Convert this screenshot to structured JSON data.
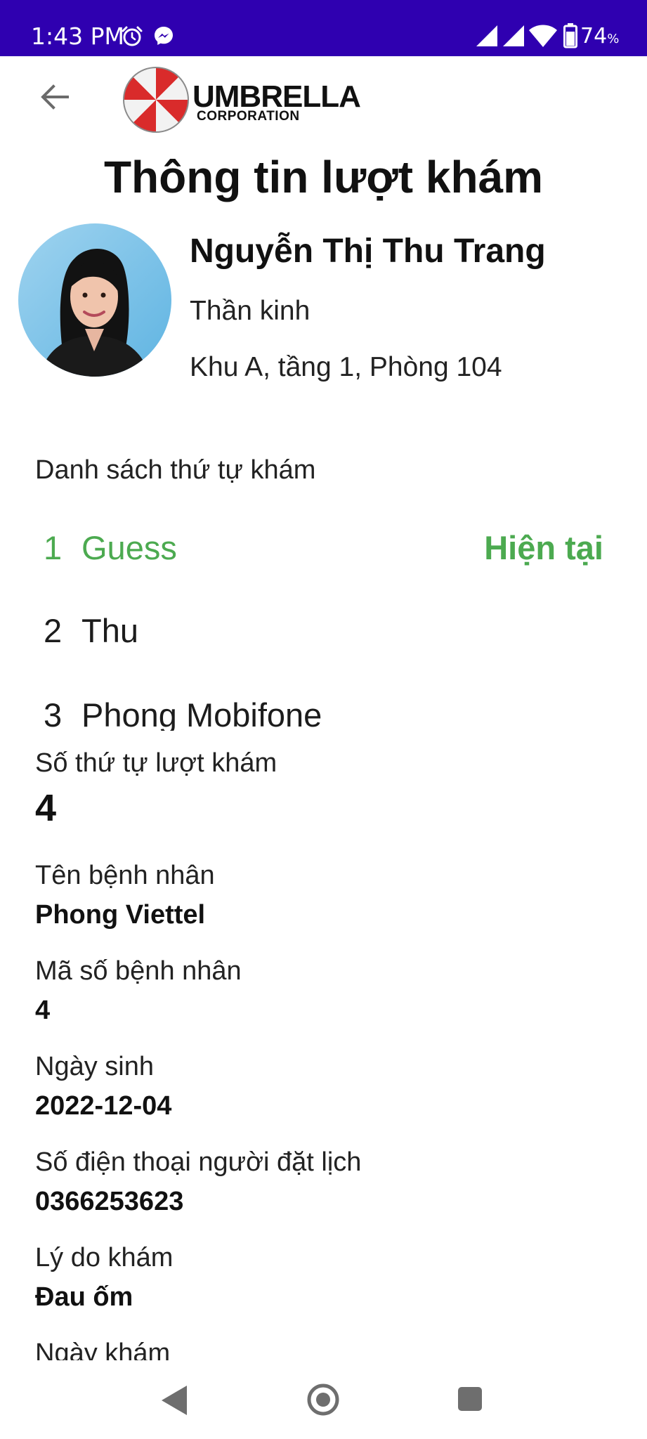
{
  "status_bar": {
    "time": "1:43 PM",
    "battery_value": "74",
    "battery_unit": "%",
    "icons": [
      "alarm-icon",
      "messenger-icon",
      "signal-icon",
      "signal-icon",
      "wifi-icon",
      "battery-icon"
    ],
    "background_color": "#2f00b0"
  },
  "header": {
    "back_icon": "arrow-left-icon",
    "logo": {
      "title": "UMBRELLA",
      "subtitle": "CORPORATION"
    },
    "title": "Thông tin lượt khám"
  },
  "doctor": {
    "name": "Nguyễn Thị Thu Trang",
    "specialty": "Thần kinh",
    "room": "Khu A, tầng 1, Phòng 104"
  },
  "queue": {
    "heading": "Danh sách thứ tự khám",
    "current_color": "#4caa50",
    "items": [
      {
        "number": "1",
        "name": "Guess",
        "status": "Hiện tại"
      },
      {
        "number": "2",
        "name": "Thu",
        "status": ""
      },
      {
        "number": "3",
        "name": "Phong Mobifone",
        "status": ""
      }
    ]
  },
  "details": {
    "fields": [
      {
        "label": "Số thứ tự lượt khám",
        "value": "4"
      },
      {
        "label": "Tên bệnh nhân",
        "value": "Phong Viettel"
      },
      {
        "label": "Mã số bệnh nhân",
        "value": "4"
      },
      {
        "label": "Ngày sinh",
        "value": "2022-12-04"
      },
      {
        "label": "Số điện thoại người đặt lịch",
        "value": "0366253623"
      },
      {
        "label": "Lý do khám",
        "value": "Đau ốm"
      },
      {
        "label": "Ngày khám",
        "value": ""
      }
    ]
  },
  "nav_bar": {
    "icons": [
      "back-triangle-icon",
      "home-circle-icon",
      "recents-square-icon"
    ]
  }
}
